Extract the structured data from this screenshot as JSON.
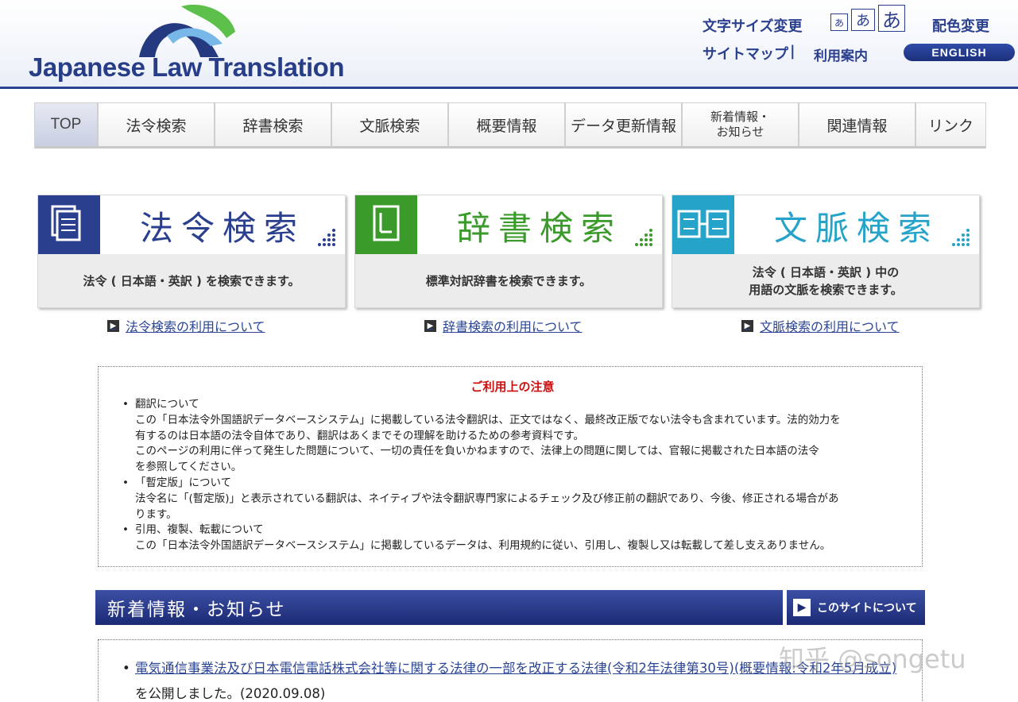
{
  "header": {
    "logo_text": "Japanese Law Translation",
    "font_size_change": "文字サイズ変更",
    "font_sizes": [
      "あ",
      "あ",
      "あ"
    ],
    "color_change": "配色変更",
    "sitemap": "サイトマップ",
    "separator": "|",
    "usage_guide": "利用案内",
    "english": "ENGLISH"
  },
  "nav": {
    "tabs": [
      {
        "label": "TOP"
      },
      {
        "label": "法令検索"
      },
      {
        "label": "辞書検索"
      },
      {
        "label": "文脈検索"
      },
      {
        "label": "概要情報"
      },
      {
        "label": "データ更新情報"
      },
      {
        "label": "新着情報・\nお知らせ"
      },
      {
        "label": "関連情報"
      },
      {
        "label": "リンク"
      }
    ]
  },
  "cards": [
    {
      "title": "法令検索",
      "desc": "法令 ( 日本語・英訳 ) を検索できます。",
      "link": "法令検索の利用について",
      "color": "#2b3f8f"
    },
    {
      "title": "辞書検索",
      "desc": "標準対訳辞書を検索できます。",
      "link": "辞書検索の利用について",
      "color": "#3a9a2a"
    },
    {
      "title": "文脈検索",
      "desc": "法令 ( 日本語・英訳 ) 中の\n用語の文脈を検索できます。",
      "link": "文脈検索の利用について",
      "color": "#26a3c8"
    }
  ],
  "notice": {
    "title": "ご利用上の注意",
    "items": [
      {
        "head": "翻訳について",
        "lines": [
          "この「日本法令外国語訳データベースシステム」に掲載している法令翻訳は、正文ではなく、最終改正版でない法令も含まれています。法的効力を",
          "有するのは日本語の法令自体であり、翻訳はあくまでその理解を助けるための参考資料です。",
          "このページの利用に伴って発生した問題について、一切の責任を負いかねますので、法律上の問題に関しては、官報に掲載された日本語の法令",
          "を参照してください。"
        ]
      },
      {
        "head": "「暫定版」について",
        "lines": [
          "法令名に「(暫定版)」と表示されている翻訳は、ネイティブや法令翻訳専門家によるチェック及び修正前の翻訳であり、今後、修正される場合があ",
          "ります。"
        ]
      },
      {
        "head": "引用、複製、転載について",
        "lines": [
          "この「日本法令外国語訳データベースシステム」に掲載しているデータは、利用規約に従い、引用し、複製し又は転載して差し支えありません。"
        ]
      }
    ]
  },
  "news": {
    "header": "新着情報・お知らせ",
    "about_site": "このサイトについて",
    "items": [
      {
        "link": "電気通信事業法及び日本電信電話株式会社等に関する法律の一部を改正する法律(令和2年法律第30号)(概要情報:令和2年5月成立)",
        "suffix": "を公開しました。(2020.09.08)"
      }
    ]
  },
  "watermark": "知乎 @songetu"
}
